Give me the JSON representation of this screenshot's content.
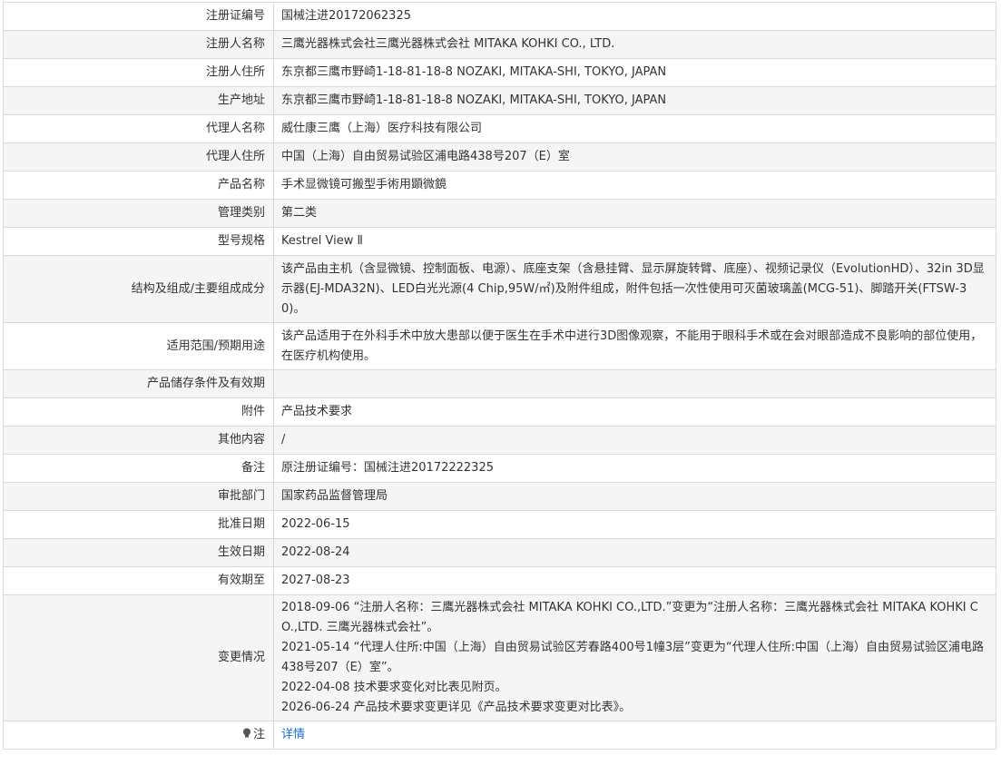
{
  "rows": [
    {
      "label": "注册证编号",
      "value": "国械注进20172062325"
    },
    {
      "label": "注册人名称",
      "value": "三鹰光器株式会社三鹰光器株式会社 MITAKA KOHKI CO., LTD."
    },
    {
      "label": "注册人住所",
      "value": "东京都三鹰市野崎1-18-81-18-8 NOZAKI, MITAKA-SHI, TOKYO, JAPAN"
    },
    {
      "label": "生产地址",
      "value": "东京都三鹰市野崎1-18-81-18-8 NOZAKI, MITAKA-SHI, TOKYO, JAPAN"
    },
    {
      "label": "代理人名称",
      "value": "威仕康三鹰（上海）医疗科技有限公司"
    },
    {
      "label": "代理人住所",
      "value": "中国（上海）自由贸易试验区浦电路438号207（E）室"
    },
    {
      "label": "产品名称",
      "value": "手术显微镜可搬型手術用顕微鏡"
    },
    {
      "label": "管理类别",
      "value": "第二类"
    },
    {
      "label": "型号规格",
      "value": "Kestrel View Ⅱ"
    },
    {
      "label": "结构及组成/主要组成成分",
      "value": "该产品由主机（含显微镜、控制面板、电源）、底座支架（含悬挂臂、显示屏旋转臂、底座）、视频记录仪（EvolutionHD）、32in 3D显示器(EJ-MDA32N)、LED白光光源(4 Chip,95W/㎡)及附件组成，附件包括一次性使用可灭菌玻璃盖(MCG-51)、脚踏开关(FTSW-30)。"
    },
    {
      "label": "适用范围/预期用途",
      "value": "该产品适用于在外科手术中放大患部以便于医生在手术中进行3D图像观察，不能用于眼科手术或在会对眼部造成不良影响的部位使用，在医疗机构使用。"
    },
    {
      "label": "产品储存条件及有效期",
      "value": ""
    },
    {
      "label": "附件",
      "value": "产品技术要求"
    },
    {
      "label": "其他内容",
      "value": "/"
    },
    {
      "label": "备注",
      "value": "原注册证编号：国械注进20172222325"
    },
    {
      "label": "审批部门",
      "value": "国家药品监督管理局"
    },
    {
      "label": "批准日期",
      "value": "2022-06-15"
    },
    {
      "label": "生效日期",
      "value": "2022-08-24"
    },
    {
      "label": "有效期至",
      "value": "2027-08-23"
    }
  ],
  "changes": {
    "label": "变更情况",
    "lines": [
      "2018-09-06 “注册人名称：三鹰光器株式会社 MITAKA KOHKI CO.,LTD.”变更为“注册人名称：三鹰光器株式会社 MITAKA KOHKI CO.,LTD. 三鹰光器株式会社”。",
      "2021-05-14 “代理人住所:中国（上海）自由贸易试验区芳春路400号1幢3层”变更为“代理人住所:中国（上海）自由贸易试验区浦电路438号207（E）室”。",
      "2022-04-08 技术要求变化对比表见附页。",
      "2026-06-24 产品技术要求变更详见《产品技术要求变更对比表》。"
    ]
  },
  "note": {
    "label": "注",
    "link_text": "详情",
    "icon": "lightbulb-icon"
  },
  "colors": {
    "border": "#d9d9d9",
    "stripe": "#f5f5f5",
    "link": "#1a6fd4"
  }
}
